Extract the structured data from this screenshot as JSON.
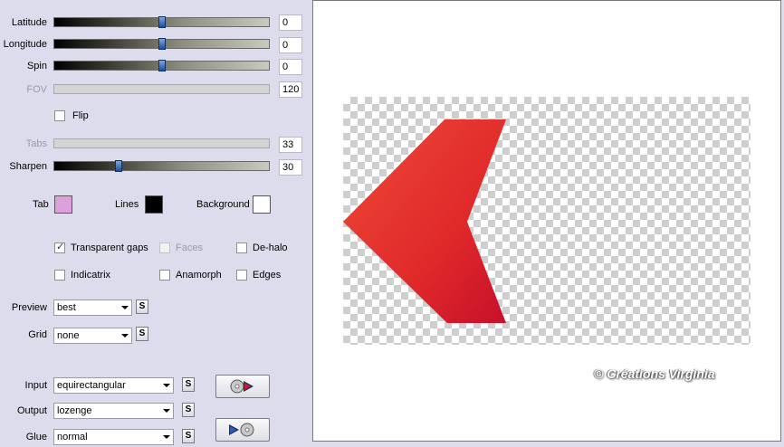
{
  "sliders": {
    "latitude": {
      "label": "Latitude",
      "value": "0",
      "position": 0.5
    },
    "longitude": {
      "label": "Longitude",
      "value": "0",
      "position": 0.5
    },
    "spin": {
      "label": "Spin",
      "value": "0",
      "position": 0.5
    },
    "fov": {
      "label": "FOV",
      "value": "120"
    },
    "tabs": {
      "label": "Tabs",
      "value": "33"
    },
    "sharpen": {
      "label": "Sharpen",
      "value": "30",
      "position": 0.3
    }
  },
  "flip": {
    "label": "Flip",
    "checked": false
  },
  "colors": {
    "tab": {
      "label": "Tab",
      "color": "#dda0dd"
    },
    "lines": {
      "label": "Lines",
      "color": "#000000"
    },
    "background": {
      "label": "Background",
      "color": "#ffffff"
    }
  },
  "options": {
    "transparent_gaps": {
      "label": "Transparent gaps",
      "checked": true
    },
    "faces": {
      "label": "Faces",
      "checked": false,
      "disabled": true
    },
    "de_halo": {
      "label": "De-halo",
      "checked": false
    },
    "indicatrix": {
      "label": "Indicatrix",
      "checked": false
    },
    "anamorph": {
      "label": "Anamorph",
      "checked": false
    },
    "edges": {
      "label": "Edges",
      "checked": false
    }
  },
  "preview": {
    "label": "Preview",
    "value": "best"
  },
  "grid": {
    "label": "Grid",
    "value": "none"
  },
  "input": {
    "label": "Input",
    "value": "equirectangular"
  },
  "output": {
    "label": "Output",
    "value": "lozenge"
  },
  "glue": {
    "label": "Glue",
    "value": "normal"
  },
  "s_button_label": "S",
  "canvas": {
    "watermark": "© Créations Virginia",
    "arrow_color": "#e03028"
  }
}
